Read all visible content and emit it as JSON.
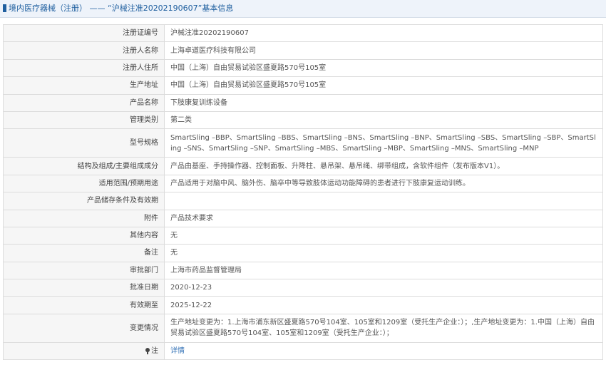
{
  "header": {
    "title": "境内医疗器械（注册） —— “沪械注准20202190607”基本信息"
  },
  "rows": [
    {
      "label": "注册证编号",
      "value": "沪械注准20202190607"
    },
    {
      "label": "注册人名称",
      "value": "上海卓道医疗科技有限公司"
    },
    {
      "label": "注册人住所",
      "value": "中国（上海）自由贸易试验区盛夏路570号105室"
    },
    {
      "label": "生产地址",
      "value": "中国（上海）自由贸易试验区盛夏路570号105室"
    },
    {
      "label": "产品名称",
      "value": "下肢康复训练设备"
    },
    {
      "label": "管理类别",
      "value": "第二类"
    },
    {
      "label": "型号规格",
      "value": "SmartSling –BBP、SmartSling –BBS、SmartSling –BNS、SmartSling –BNP、SmartSling –SBS、SmartSling –SBP、SmartSling –SNS、SmartSling –SNP、SmartSling –MBS、SmartSling –MBP、SmartSling –MNS、SmartSling –MNP"
    },
    {
      "label": "结构及组成/主要组成成分",
      "value": "产品由基座、手持操作器、控制面板、升降柱、悬吊架、悬吊绳、绑带组成，含软件组件（发布版本V1）。"
    },
    {
      "label": "适用范围/预期用途",
      "value": "产品适用于对脑中风、脑外伤、脑卒中等导致肢体运动功能障碍的患者进行下肢康复运动训练。"
    },
    {
      "label": "产品储存条件及有效期",
      "value": ""
    },
    {
      "label": "附件",
      "value": "产品技术要求"
    },
    {
      "label": "其他内容",
      "value": "无"
    },
    {
      "label": "备注",
      "value": "无"
    },
    {
      "label": "审批部门",
      "value": "上海市药品监督管理局"
    },
    {
      "label": "批准日期",
      "value": "2020-12-23"
    },
    {
      "label": "有效期至",
      "value": "2025-12-22"
    },
    {
      "label": "变更情况",
      "value": "生产地址变更为：1.上海市浦东新区盛夏路570号104室、105室和1209室（受托生产企业：）；,生产地址变更为：1.中国（上海）自由贸易试验区盛夏路570号104室、105室和1209室（受托生产企业：）；"
    }
  ],
  "footer_row": {
    "label": "注",
    "link_text": "详情"
  },
  "colors": {
    "title_text": "#1f5f9f",
    "title_bg": "#eef3fa",
    "label_bg": "#f6f6f6",
    "border": "#dcdcdc",
    "link": "#2f6fb5"
  }
}
